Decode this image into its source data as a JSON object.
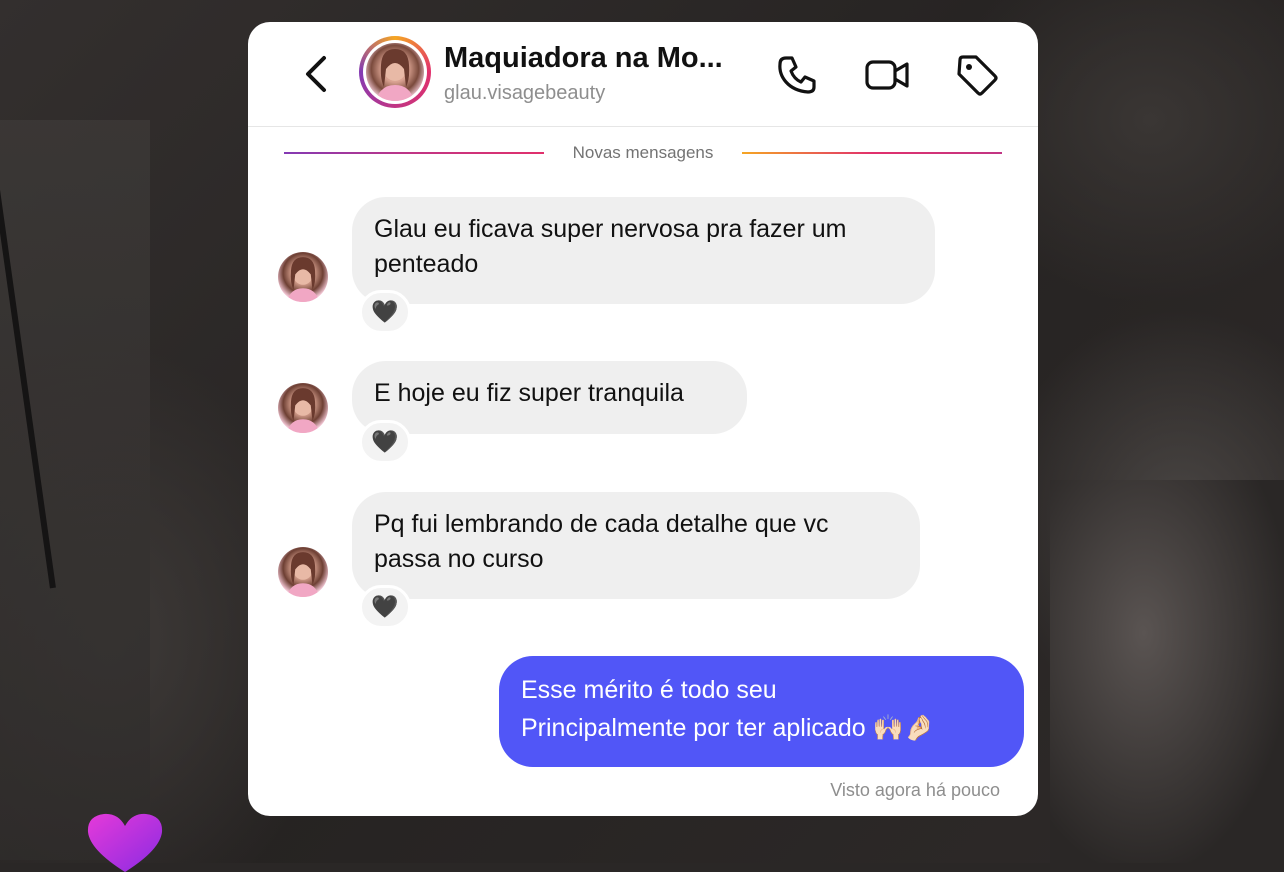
{
  "header": {
    "contact_name": "Maquiadora na Mo...",
    "username": "glau.visagebeauty",
    "icons": [
      "back-icon",
      "phone-icon",
      "video-icon",
      "tag-icon"
    ]
  },
  "divider": {
    "label": "Novas mensagens"
  },
  "messages": [
    {
      "direction": "incoming",
      "line1": "Glau eu ficava super nervosa pra fazer um",
      "line2": "penteado",
      "reaction": "🖤"
    },
    {
      "direction": "incoming",
      "line1": "E hoje eu fiz super tranquila",
      "reaction": "🖤"
    },
    {
      "direction": "incoming",
      "line1": "Pq fui lembrando de cada detalhe que vc",
      "line2": "passa no curso",
      "reaction": "🖤"
    },
    {
      "direction": "outgoing",
      "line1": "Esse mérito é todo seu",
      "line2": "Principalmente por ter aplicado 🙌🏻🤌🏻"
    }
  ],
  "status": {
    "seen": "Visto agora há pouco"
  },
  "colors": {
    "outgoing_bubble": "#5156f7",
    "incoming_bubble": "#efefef",
    "heart_gradient_start": "#e53ad9",
    "heart_gradient_end": "#8a2be2"
  }
}
